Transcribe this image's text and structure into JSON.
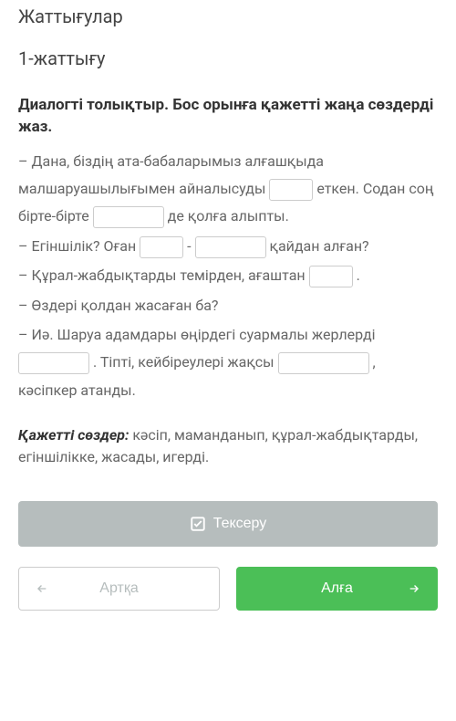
{
  "page": {
    "category": "Жаттығулар",
    "exercise_title": "1-жаттығу"
  },
  "instructions": "Диалогті толықтыр. Бос орынға қажетті жаңа сөздерді жаз.",
  "dialogue": {
    "l1a": "– Дана, біздің ата-бабаларымыз алғашқыда малшаруашылығымен айналысуды ",
    "l1b": " еткен. Содан соң бірте-бірте ",
    "l1c": " де қолға алыпты.",
    "l2a": "– Егіншілік? Оған ",
    "l2b": " - ",
    "l2c": " қайдан алған?",
    "l3a": "– Құрал-жабдықтарды темірден, ағаштан ",
    "l3b": " .",
    "l4": "– Өздері қолдан жасаған ба?",
    "l5a": "– Иә. Шаруа адамдары өңірдегі суармалы жерлерді ",
    "l5b": " . Тіпті, кейбіреулері жақсы ",
    "l5c": " , кәсіпкер атанды."
  },
  "word_bank": {
    "label": "Қажетті сөздер:",
    "words": " кәсіп, маманданып, құрал-жабдықтарды, егіншілікке, жасады, игерді."
  },
  "buttons": {
    "check": "Тексеру",
    "back": "Артқа",
    "forward": "Алға"
  }
}
